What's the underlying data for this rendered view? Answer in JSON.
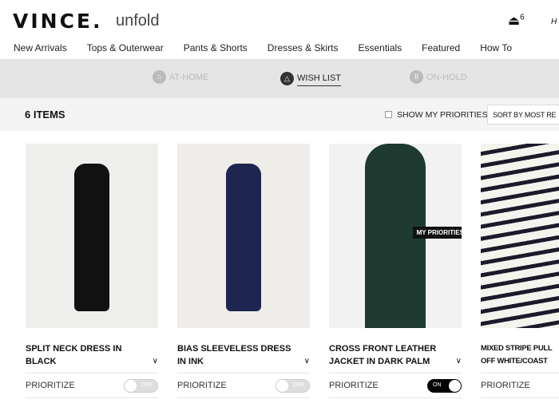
{
  "header": {
    "logo": "VINCE.",
    "logo_sub": "unfold",
    "bag_count": "6",
    "cut_text": "H"
  },
  "nav": [
    "New Arrivals",
    "Tops & Outerwear",
    "Pants & Shorts",
    "Dresses & Skirts",
    "Essentials",
    "Featured",
    "How To"
  ],
  "subnav": [
    {
      "label": "AT-HOME",
      "icon": "home-icon"
    },
    {
      "label": "WISH LIST",
      "icon": "hanger-icon",
      "active": true
    },
    {
      "label": "ON-HOLD",
      "icon": "pause-icon"
    }
  ],
  "toolbar": {
    "count": "6 ITEMS",
    "show_priorities": "SHOW MY PRIORITIES",
    "sort": "SORT BY MOST RE"
  },
  "products": [
    {
      "title": "SPLIT NECK DRESS IN BLACK",
      "prioritize": "PRIORITIZE",
      "toggle": "OFF",
      "bg": "#eeeeec",
      "fig": "#111"
    },
    {
      "title": "BIAS SLEEVELESS DRESS IN INK",
      "prioritize": "PRIORITIZE",
      "toggle": "OFF",
      "bg": "#efedea",
      "fig": "#1d2550"
    },
    {
      "title": "CROSS FRONT LEATHER JACKET IN DARK PALM",
      "prioritize": "PRIORITIZE",
      "toggle": "ON",
      "badge": "MY PRIORITIES",
      "bg": "#f2f2f2",
      "fig": "#1f3a30"
    },
    {
      "title": "MIXED STRIPE PULL OFF WHITE/COAST",
      "prioritize": "PRIORITIZE",
      "toggle": "",
      "bg": "#e8e4df",
      "fig": "#f5f3ee"
    }
  ]
}
